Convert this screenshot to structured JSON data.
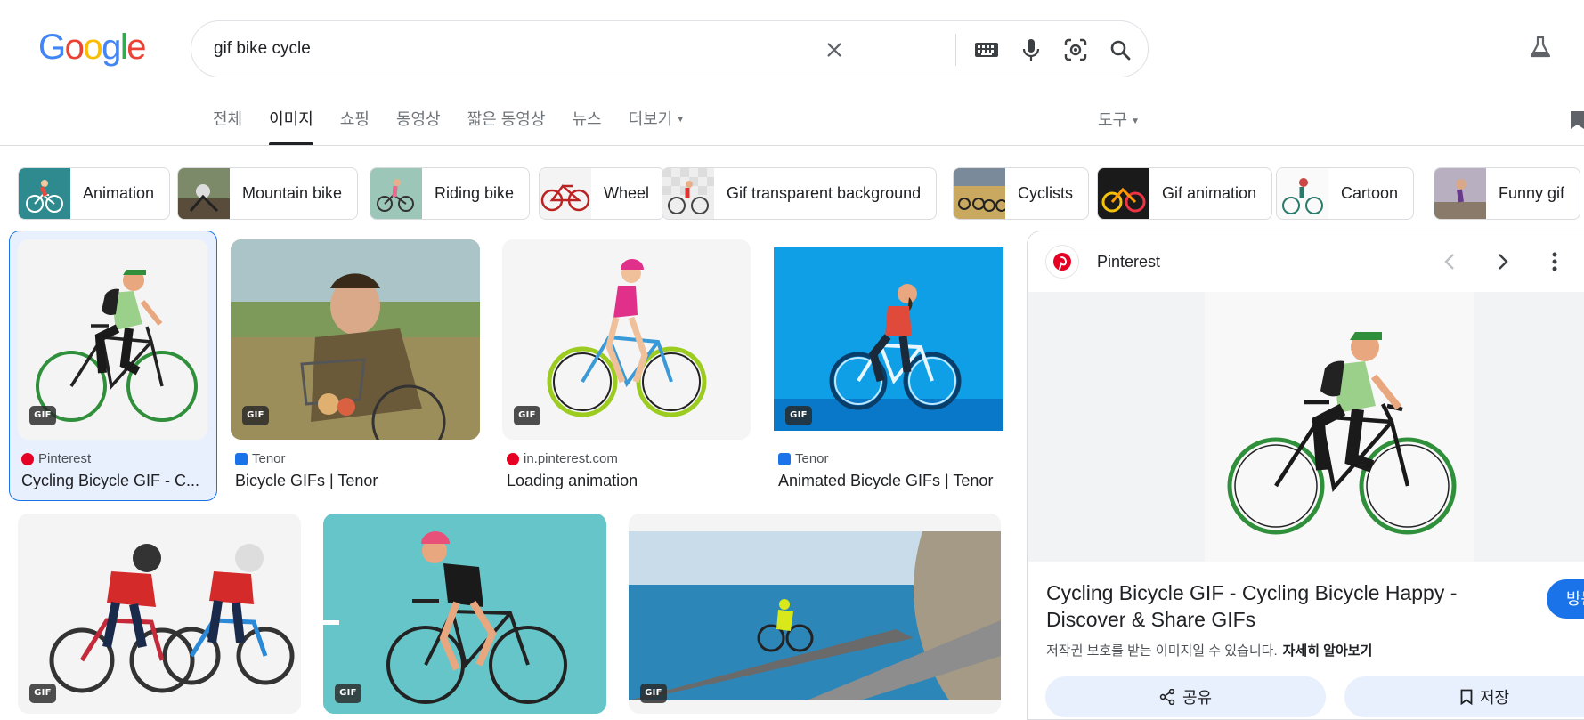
{
  "logo": {
    "letters": [
      "G",
      "o",
      "o",
      "g",
      "l",
      "e"
    ],
    "colors": [
      "#4285F4",
      "#EA4335",
      "#FBBC05",
      "#4285F4",
      "#34A853",
      "#EA4335"
    ]
  },
  "search": {
    "query": "gif bike cycle"
  },
  "tabs": [
    {
      "label": "전체",
      "active": false
    },
    {
      "label": "이미지",
      "active": true
    },
    {
      "label": "쇼핑",
      "active": false
    },
    {
      "label": "동영상",
      "active": false
    },
    {
      "label": "짧은 동영상",
      "active": false
    },
    {
      "label": "뉴스",
      "active": false
    },
    {
      "label": "더보기",
      "active": false
    }
  ],
  "tools_label": "도구",
  "chips": [
    "Animation",
    "Mountain bike",
    "Riding bike",
    "Wheel",
    "Gif transparent background",
    "Cyclists",
    "Gif animation",
    "Cartoon",
    "Funny gif"
  ],
  "gif_badge": "GIF",
  "results": [
    {
      "source": "Pinterest",
      "title": "Cycling Bicycle GIF - C...",
      "selected": true
    },
    {
      "source": "Tenor",
      "title": "Bicycle GIFs | Tenor"
    },
    {
      "source": "in.pinterest.com",
      "title": "Loading animation"
    },
    {
      "source": "Tenor",
      "title": "Animated Bicycle GIFs | Tenor"
    }
  ],
  "panel": {
    "source": "Pinterest",
    "title": "Cycling Bicycle GIF - Cycling Bicycle Happy - Discover & Share GIFs",
    "visit_label": "방문",
    "copyright": "저작권 보호를 받는 이미지일 수 있습니다.",
    "learn_more": "자세히 알아보기",
    "share_label": "공유",
    "save_label": "저장"
  },
  "colors": {
    "accent": "#1a73e8",
    "selected_bg": "#e8f0fe",
    "pinterest": "#E60023",
    "tenor": "#1a73e8"
  }
}
